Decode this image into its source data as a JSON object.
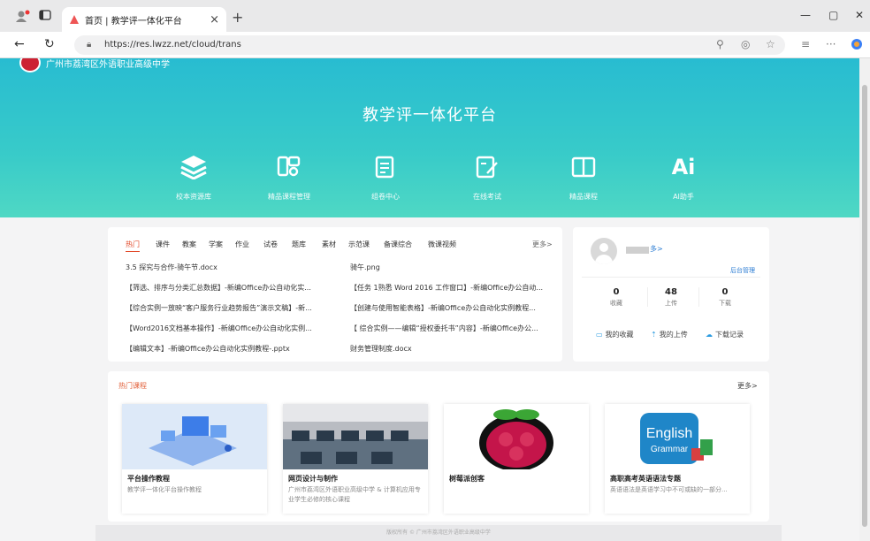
{
  "browser": {
    "tab_title": "首页 | 教学评一体化平台",
    "tab_close": "×",
    "new_tab": "+",
    "url": "https://res.lwzz.net/cloud/trans"
  },
  "hero": {
    "school_name": "广州市荔湾区外语职业高级中学",
    "title": "教学评一体化平台",
    "features": [
      {
        "label": "校本资源库"
      },
      {
        "label": "精品课程管理"
      },
      {
        "label": "组卷中心"
      },
      {
        "label": "在线考试"
      },
      {
        "label": "精品课程"
      },
      {
        "label": "AI助手",
        "icon_text": "Ai"
      }
    ]
  },
  "resources": {
    "tabs": [
      "热门",
      "课件",
      "教案",
      "学案",
      "作业",
      "试卷",
      "题库",
      "素材",
      "示范课",
      "备课综合",
      "微课视频"
    ],
    "more": "更多>",
    "items_left": [
      "3.5 探究与合作-骑午节.docx",
      "【筛选、排序与分类汇总数据】-新编Office办公自动化实...",
      "【综合实例一放映“客户服务行业趋势报告”演示文稿】-新...",
      "【Word2016文档基本操作】-新编Office办公自动化实例...",
      "【编辑文本】-新编Office办公自动化实例教程-.pptx"
    ],
    "items_right": [
      "骑午.png",
      "【任务 1熟悉 Word 2016 工作窗口】-新编Office办公自动...",
      "【创建与使用智能表格】-新编Office办公自动化实例教程...",
      "【 综合实例——编辑“授权委托书”内容】-新编Office办公...",
      "财务管理制度.docx"
    ]
  },
  "user": {
    "name_tail": "多>",
    "admin": "后台管理",
    "stats": [
      {
        "value": "0",
        "label": "收藏"
      },
      {
        "value": "48",
        "label": "上传"
      },
      {
        "value": "0",
        "label": "下载"
      }
    ],
    "links": [
      "我的收藏",
      "我的上传",
      "下载记录"
    ]
  },
  "courses": {
    "heading": "热门课程",
    "more": "更多>",
    "list": [
      {
        "name": "平台操作教程",
        "desc": "教学评一体化平台操作教程"
      },
      {
        "name": "网页设计与制作",
        "desc": "广州市荔湾区外语职业高级中学 & 计算机应用专业学生必修的核心课程"
      },
      {
        "name": "树莓派创客",
        "desc": ""
      },
      {
        "name": "高职高考英语语法专题",
        "desc": "英语语法是英语学习中不可或缺的一部分..."
      }
    ],
    "english_line1": "English",
    "english_line2": "Grammar"
  },
  "footer": "版权所有 © 广州市荔湾区外语职业高级中学",
  "colors": {
    "hero_top": "#28bcd1",
    "hero_bottom": "#4fd8c4",
    "accent": "#e24a2a",
    "link": "#2b7cd3"
  }
}
